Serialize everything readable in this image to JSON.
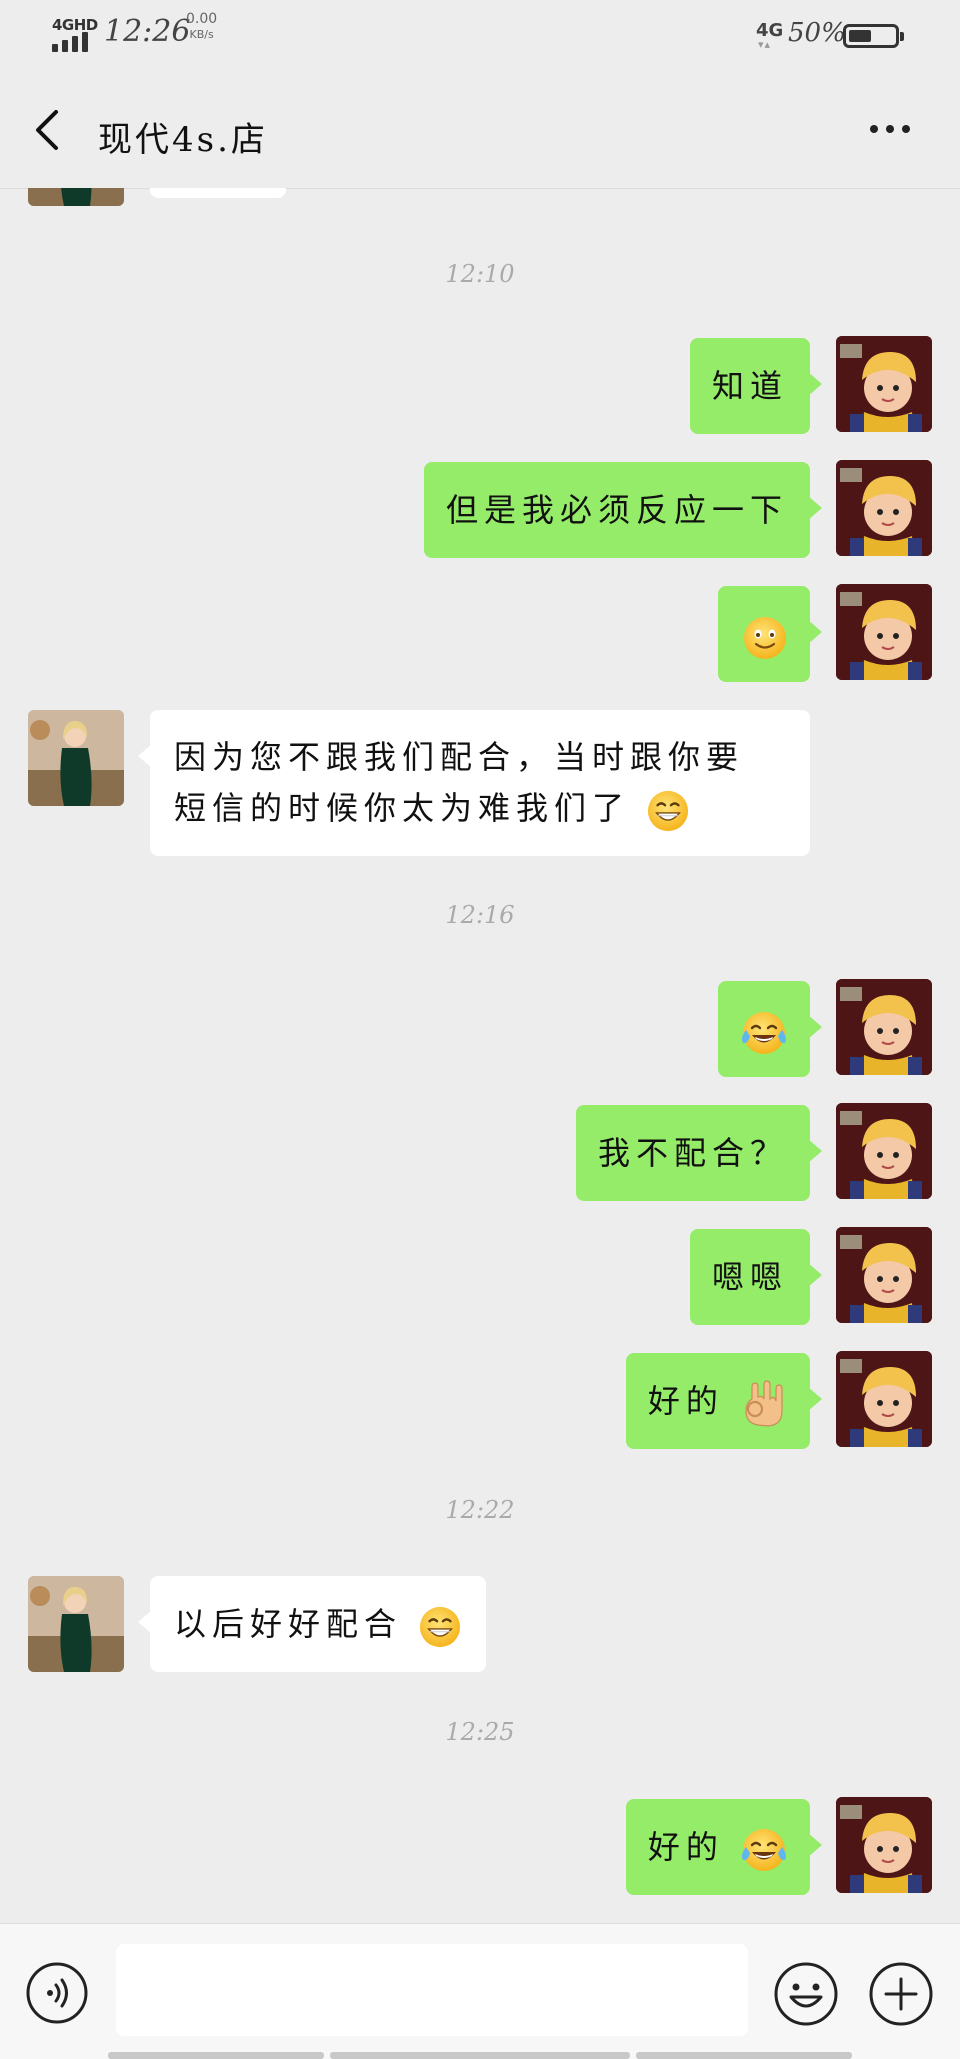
{
  "status_bar": {
    "network": "4GHD",
    "time": "12:26",
    "speed_value": "0.00",
    "speed_unit": "KB/s",
    "mobile_data": "4G",
    "battery_pct": "50%",
    "battery_level": 0.5
  },
  "header": {
    "title": "现代4s.店",
    "back_icon": "chevron-left-icon",
    "more_icon": "more-dots-icon"
  },
  "chat": {
    "timestamps": [
      "12:10",
      "12:16",
      "12:22",
      "12:25"
    ],
    "messages": [
      {
        "side": "out",
        "text": "知道"
      },
      {
        "side": "out",
        "text": "但是我必须反应一下"
      },
      {
        "side": "out",
        "text": "",
        "emoji": "smile-emoji"
      },
      {
        "side": "in",
        "line1": "因为您不跟我们配合，当时跟你要",
        "line2": "短信的时候你太为难我们了",
        "emoji": "grin-emoji"
      },
      {
        "side": "out",
        "text": "",
        "emoji": "tears-of-joy-emoji"
      },
      {
        "side": "out",
        "text": "我不配合？"
      },
      {
        "side": "out",
        "text": "嗯嗯"
      },
      {
        "side": "out",
        "text": "好的",
        "emoji": "ok-hand-emoji"
      },
      {
        "side": "in",
        "text": "以后好好配合",
        "emoji": "grin-emoji"
      },
      {
        "side": "out",
        "text": "好的",
        "emoji": "tears-of-joy-emoji"
      }
    ]
  },
  "composer": {
    "input_value": "",
    "voice_icon": "voice-icon",
    "emoji_icon": "emoji-icon",
    "plus_icon": "plus-icon"
  },
  "colors": {
    "background": "#ededed",
    "outgoing_bubble": "#95ec69",
    "incoming_bubble": "#ffffff"
  }
}
